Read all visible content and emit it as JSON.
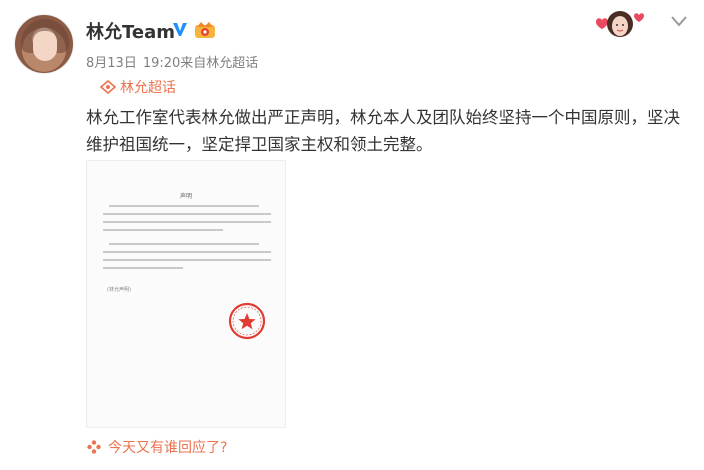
{
  "post": {
    "author": "林允Team",
    "date": "8月13日",
    "time": "19:20",
    "source": "来自林允超话",
    "super_topic": "林允超话",
    "text": "林允工作室代表林允做出严正声明，林允本人及团队始终坚持一个中国原则，坚决维护祖国统一，坚定捍卫国家主权和领土完整。",
    "image": {
      "title": "声明",
      "sign": "(林允声明)"
    }
  },
  "footer": {
    "comment_hint": "今天又有谁回应了?"
  },
  "colors": {
    "accent": "#eb7350",
    "verified": "#1e90ff",
    "text": "#333333",
    "muted": "#808080",
    "stamp": "#e03c31"
  },
  "icons": {
    "verified": "verified-v-icon",
    "member": "member-crown-icon",
    "chevron": "chevron-down-icon",
    "super_topic": "super-topic-icon",
    "comment": "flower-icon"
  }
}
